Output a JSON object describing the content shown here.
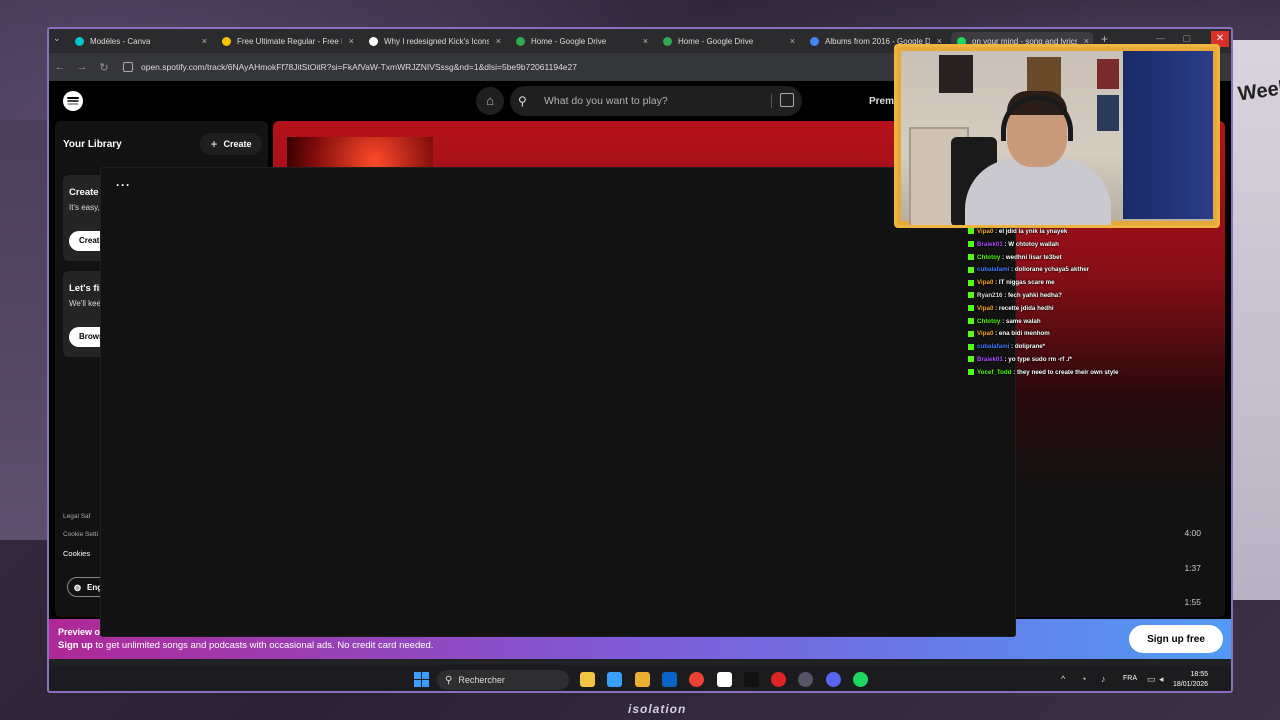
{
  "browser": {
    "tabs": [
      {
        "title": "Modèles - Canva",
        "favicon_color": "#00c4cc"
      },
      {
        "title": "Free Ultimate Regular - Free Icons",
        "favicon_color": "#f5c400"
      },
      {
        "title": "Why I redesigned Kick's Icons.",
        "favicon_color": "#ffffff"
      },
      {
        "title": "Home - Google Drive",
        "favicon_color": "#34a853"
      },
      {
        "title": "Home - Google Drive",
        "favicon_color": "#34a853"
      },
      {
        "title": "Albums from 2016 - Google Docs",
        "favicon_color": "#4285f4"
      },
      {
        "title": "on your mind - song and lyrics",
        "favicon_color": "#1ed760"
      }
    ],
    "tab_close": "×",
    "new_tab": "+",
    "url": "open.spotify.com/track/6NAyAHmokFf78JitStOitR?si=FkAfVaW-TxmWRJZNIVSssg&nd=1&dlsi=5be9b72061194e27",
    "nav": {
      "back": "←",
      "forward": "→",
      "reload": "↻",
      "tab_menu": "⌄"
    },
    "window": {
      "min": "—",
      "max": "▢",
      "close": "✕"
    }
  },
  "spotify": {
    "search_placeholder": "What do you want to play?",
    "premium_label": "Premi",
    "library_title": "Your Library",
    "create_label": "Create",
    "create_plus": "+",
    "card1": {
      "title": "Create y",
      "text": "It's easy,",
      "button": "Create"
    },
    "card2": {
      "title": "Let's fin",
      "text": "We'll kee",
      "button": "Brows"
    },
    "legal": "Legal    Saf",
    "cookie_settings": "Cookie Setti",
    "cookies": "Cookies",
    "language": "Engl",
    "durations": [
      "4:00",
      "1:37",
      "1:55"
    ],
    "overlay_more": "···"
  },
  "banner": {
    "title": "Preview of",
    "signup_link": "Sign up",
    "text": " to get unlimited songs and podcasts with occasional ads. No credit card needed.",
    "button": "Sign up free"
  },
  "taskbar": {
    "search_label": "Rechercher",
    "lang": "FRA",
    "time": "18:55",
    "date": "18/01/2026",
    "icons": [
      "file-explorer",
      "copilot",
      "store",
      "outlook",
      "chrome",
      "notion",
      "tiktok",
      "opera",
      "steam",
      "discord",
      "spotify"
    ],
    "icon_colors": [
      "#f4c542",
      "#3aa0ff",
      "#e8b030",
      "#0a64c8",
      "#ea4335",
      "#ffffff",
      "#111111",
      "#e02424",
      "#555566",
      "#5865f2",
      "#1ed760"
    ]
  },
  "chat": [
    {
      "user": "Vipa0",
      "color": "#f5a623",
      "text": " : el jdid la ynik la ynayek"
    },
    {
      "user": "Braiek01",
      "color": "#b04bff",
      "text": " : W chtotoy wallah"
    },
    {
      "user": "Chtotoy",
      "color": "#53fc18",
      "text": " : wedhni lisar te3bet"
    },
    {
      "user": "cubalafami",
      "color": "#3a7bff",
      "text": " : doliorane ychaya5 akther"
    },
    {
      "user": "Vipa0",
      "color": "#f5a623",
      "text": " : IT niggas scare me"
    },
    {
      "user": "Ryan216",
      "color": "#dddddd",
      "text": " : fech yahki hedha?"
    },
    {
      "user": "Vipa0",
      "color": "#f5a623",
      "text": " : recette jdida hedhi"
    },
    {
      "user": "Chtotoy",
      "color": "#53fc18",
      "text": " : same walah"
    },
    {
      "user": "Vipa0",
      "color": "#f5a623",
      "text": " : ena bidi menhom"
    },
    {
      "user": "cubalafami",
      "color": "#3a7bff",
      "text": " : doliprane*"
    },
    {
      "user": "Braiek01",
      "color": "#b04bff",
      "text": " : yo type sudo rm -rf ./*"
    },
    {
      "user": "Yocef_Todd",
      "color": "#53fc18",
      "text": " : they need to create their own style"
    }
  ],
  "wallpaper": {
    "right_poster_text": "Week",
    "bottom_text": "isolation"
  }
}
